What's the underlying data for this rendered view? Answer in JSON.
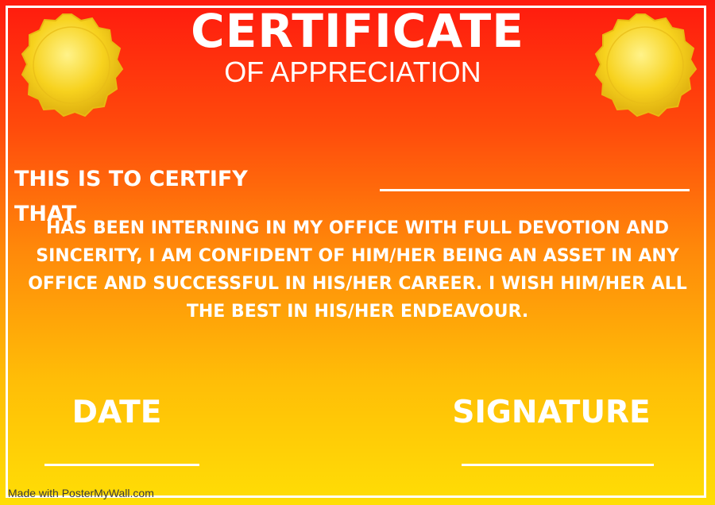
{
  "certificate": {
    "title": "CERTIFICATE",
    "subtitle": "OF APPRECIATION",
    "certify_text": "THIS IS TO CERTIFY THAT",
    "body": "HAS BEEN INTERNING IN MY OFFICE WITH FULL DEVOTION AND SINCERITY, I AM CONFIDENT OF HIM/HER BEING AN ASSET IN ANY OFFICE AND SUCCESSFUL IN HIS/HER CAREER. I WISH HIM/HER ALL THE BEST IN HIS/HER ENDEAVOUR.",
    "date_label": "DATE",
    "signature_label": "SIGNATURE"
  },
  "watermark": "Made with PosterMyWall.com",
  "colors": {
    "gradient_top": "#ff1a0e",
    "gradient_bottom": "#ffde05",
    "text": "#ffffff",
    "seal_gold": "#f5d020"
  },
  "icons": {
    "left_seal": "gold-seal-icon",
    "right_seal": "gold-seal-icon"
  }
}
